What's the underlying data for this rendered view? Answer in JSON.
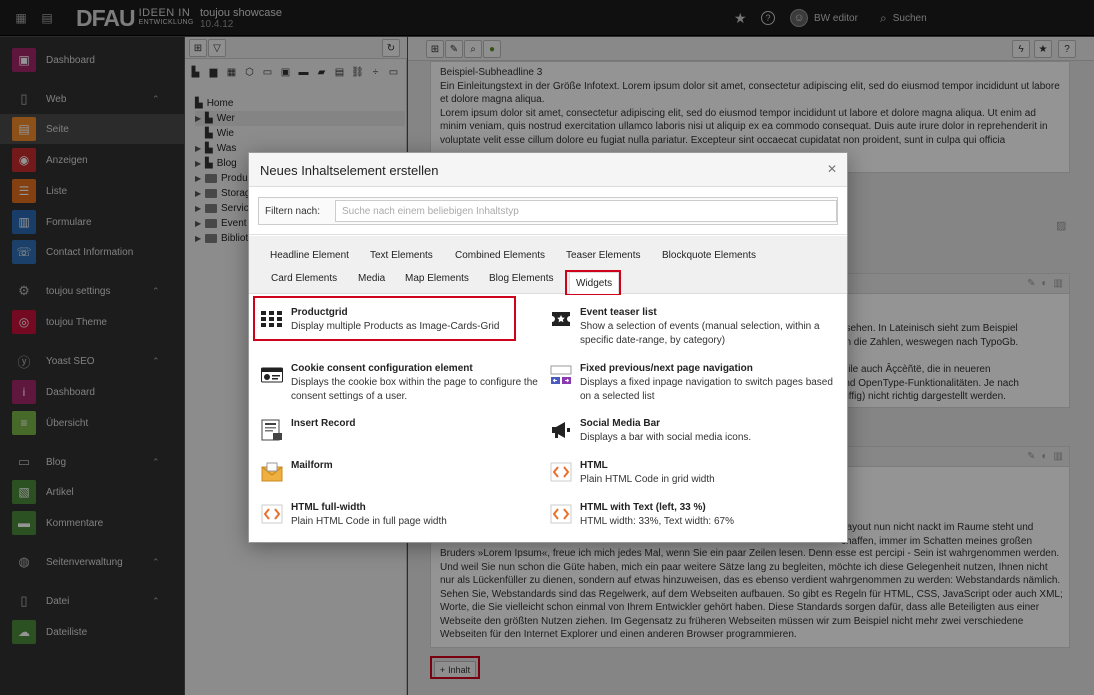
{
  "topbar": {
    "logo_main": "DFAU",
    "logo_line1": "IDEEN IN",
    "logo_line2": "ENTWICKLUNG",
    "site_name": "toujou showcase",
    "version": "10.4.12",
    "user_name": "BW editor",
    "search_label": "Suchen",
    "search_icon": "search-icon",
    "star_icon": "star-icon",
    "help_icon": "help-icon"
  },
  "modules": [
    {
      "label": "Dashboard",
      "type": "item",
      "color": "#a4276a",
      "icon": "dashboard-icon"
    },
    {
      "label": "Web",
      "type": "group",
      "icon": "page-icon"
    },
    {
      "label": "Seite",
      "type": "item",
      "color": "#f08c2c",
      "icon": "page-module-icon",
      "active": true
    },
    {
      "label": "Anzeigen",
      "type": "item",
      "color": "#c92b2b",
      "icon": "eye-icon"
    },
    {
      "label": "Liste",
      "type": "item",
      "color": "#e46f1e",
      "icon": "list-icon"
    },
    {
      "label": "Formulare",
      "type": "item",
      "color": "#2a6ab3",
      "icon": "form-icon"
    },
    {
      "label": "Contact Information",
      "type": "item",
      "color": "#2f6fb5",
      "icon": "contact-icon"
    },
    {
      "label": "toujou settings",
      "type": "group",
      "icon": "gear-icon"
    },
    {
      "label": "toujou Theme",
      "type": "item",
      "color": "#c8103c",
      "icon": "fingerprint-icon"
    },
    {
      "label": "Yoast SEO",
      "type": "group",
      "icon": "yoast-icon"
    },
    {
      "label": "Dashboard",
      "type": "item",
      "color": "#a4286a",
      "icon": "info-icon"
    },
    {
      "label": "Übersicht",
      "type": "item",
      "color": "#7ab648",
      "icon": "overview-icon"
    },
    {
      "label": "Blog",
      "type": "group",
      "icon": "blog-icon"
    },
    {
      "label": "Artikel",
      "type": "item",
      "color": "#4a8b3a",
      "icon": "article-icon"
    },
    {
      "label": "Kommentare",
      "type": "item",
      "color": "#4a8b3a",
      "icon": "comment-icon"
    },
    {
      "label": "Seitenverwaltung",
      "type": "group",
      "icon": "globe-icon"
    },
    {
      "label": "Datei",
      "type": "group",
      "icon": "file-icon"
    },
    {
      "label": "Dateiliste",
      "type": "item",
      "color": "#4a8b3a",
      "icon": "cloud-icon"
    }
  ],
  "tree": {
    "items": [
      {
        "label": "Home",
        "depth": 0,
        "kind": "page"
      },
      {
        "label": "Wer",
        "depth": 1,
        "kind": "page",
        "expandable": true
      },
      {
        "label": "Wie",
        "depth": 1,
        "kind": "page",
        "expandable": false
      },
      {
        "label": "Was",
        "depth": 1,
        "kind": "page",
        "expandable": true
      },
      {
        "label": "Blog",
        "depth": 1,
        "kind": "page",
        "expandable": true
      },
      {
        "label": "Produ",
        "depth": 1,
        "kind": "folder",
        "expandable": true
      },
      {
        "label": "Storag",
        "depth": 1,
        "kind": "folder",
        "expandable": true
      },
      {
        "label": "Servic",
        "depth": 1,
        "kind": "folder",
        "expandable": true
      },
      {
        "label": "Event",
        "depth": 1,
        "kind": "folder",
        "expandable": true
      },
      {
        "label": "Bibliot",
        "depth": 1,
        "kind": "folder",
        "expandable": true
      }
    ]
  },
  "main": {
    "top_text": [
      "Beispiel-Subheadline 3",
      "Ein Einleitungstext in der Größe Infotext. Lorem ipsum dolor sit amet, consectetur adipiscing elit, sed do eiusmod tempor incididunt ut labore et dolore magna aliqua.",
      "Lorem ipsum dolor sit amet, consectetur adipiscing elit, sed do eiusmod tempor incididunt ut labore et dolore magna aliqua. Ut enim ad minim veniam, quis nostrud exercitation ullamco laboris nisi ut aliquip ex ea commodo consequat. Duis aute irure dolor in reprehenderit in voluptate velit esse cillum dolore eu fugiat nulla pariatur. Excepteur sint occaecat cupidatat non proident, sunt in culpa qui officia"
    ],
    "mid_text_1": "e aussehen. In Lateinisch sieht zum Beispiel",
    "mid_text_2": "ttexten die Zahlen, weswegen nach TypoGb.",
    "mid_text_3": "derweile auch Âçcèñtë, die in neueren",
    "mid_text_4": "eld sind OpenType-Funktionalitäten. Je nach",
    "mid_text_5": "ehr pfiffig) nicht richtig dargestellt werden.",
    "lower_text_1": "Layout nun nicht nackt im Raume steht und",
    "lower_text_2": "chaffen, immer im Schatten meines großen",
    "bottom_text": "Bruders »Lorem Ipsum«, freue ich mich jedes Mal, wenn Sie ein paar Zeilen lesen. Denn esse est percipi - Sein ist wahrgenommen werden. Und weil Sie nun schon die Güte haben, mich ein paar weitere Sätze lang zu begleiten, möchte ich diese Gelegenheit nutzen, Ihnen nicht nur als Lückenfüller zu dienen, sondern auf etwas hinzuweisen, das es ebenso verdient wahrgenommen zu werden: Webstandards nämlich. Sehen Sie, Webstandards sind das Regelwerk, auf dem Webseiten aufbauen. So gibt es Regeln für HTML, CSS, JavaScript oder auch XML; Worte, die Sie vielleicht schon einmal von Ihrem Entwickler gehört haben. Diese Standards sorgen dafür, dass alle Beteiligten aus einer Webseite den größten Nutzen ziehen. Im Gegensatz zu früheren Webseiten müssen wir zum Beispiel nicht mehr zwei verschiedene Webseiten für den Internet Explorer und einen anderen Browser programmieren.",
    "add_content_label": "Inhalt"
  },
  "modal": {
    "title": "Neues Inhaltselement erstellen",
    "filter_label": "Filtern nach:",
    "filter_placeholder": "Suche nach einem beliebigen Inhaltstyp",
    "tabs_row1": [
      "Headline Element",
      "Text Elements",
      "Combined Elements",
      "Teaser Elements",
      "Blockquote Elements"
    ],
    "tabs_row2": [
      "Card Elements",
      "Media",
      "Map Elements",
      "Blog Elements",
      "Widgets"
    ],
    "active_tab": "Widgets",
    "items": [
      {
        "title": "Productgrid",
        "desc": "Display multiple Products as Image-Cards-Grid",
        "icon": "grid-icon"
      },
      {
        "title": "Event teaser list",
        "desc": "Show a selection of events (manual selection, within a specific date-range, by category)",
        "icon": "ticket-icon"
      },
      {
        "title": "Cookie consent configuration element",
        "desc": "Displays the cookie box within the page to configure the consent settings of a user.",
        "icon": "cookie-consent-icon"
      },
      {
        "title": "Fixed previous/next page navigation",
        "desc": "Displays a fixed inpage navigation to switch pages based on a selected list",
        "icon": "page-navigation-icon"
      },
      {
        "title": "Insert Record",
        "desc": "",
        "icon": "insert-record-icon"
      },
      {
        "title": "Social Media Bar",
        "desc": "Displays a bar with social media icons.",
        "icon": "megaphone-icon"
      },
      {
        "title": "Mailform",
        "desc": "",
        "icon": "mailform-icon"
      },
      {
        "title": "HTML",
        "desc": "Plain HTML Code in grid width",
        "icon": "html-icon"
      },
      {
        "title": "HTML full-width",
        "desc": "Plain HTML Code in full page width",
        "icon": "html-icon"
      },
      {
        "title": "HTML with Text (left, 33 %)",
        "desc": "HTML width: 33%, Text width: 67%",
        "icon": "html-icon"
      }
    ]
  },
  "colors": {
    "highlight": "#d0021b",
    "html_orange": "#e8702a"
  }
}
